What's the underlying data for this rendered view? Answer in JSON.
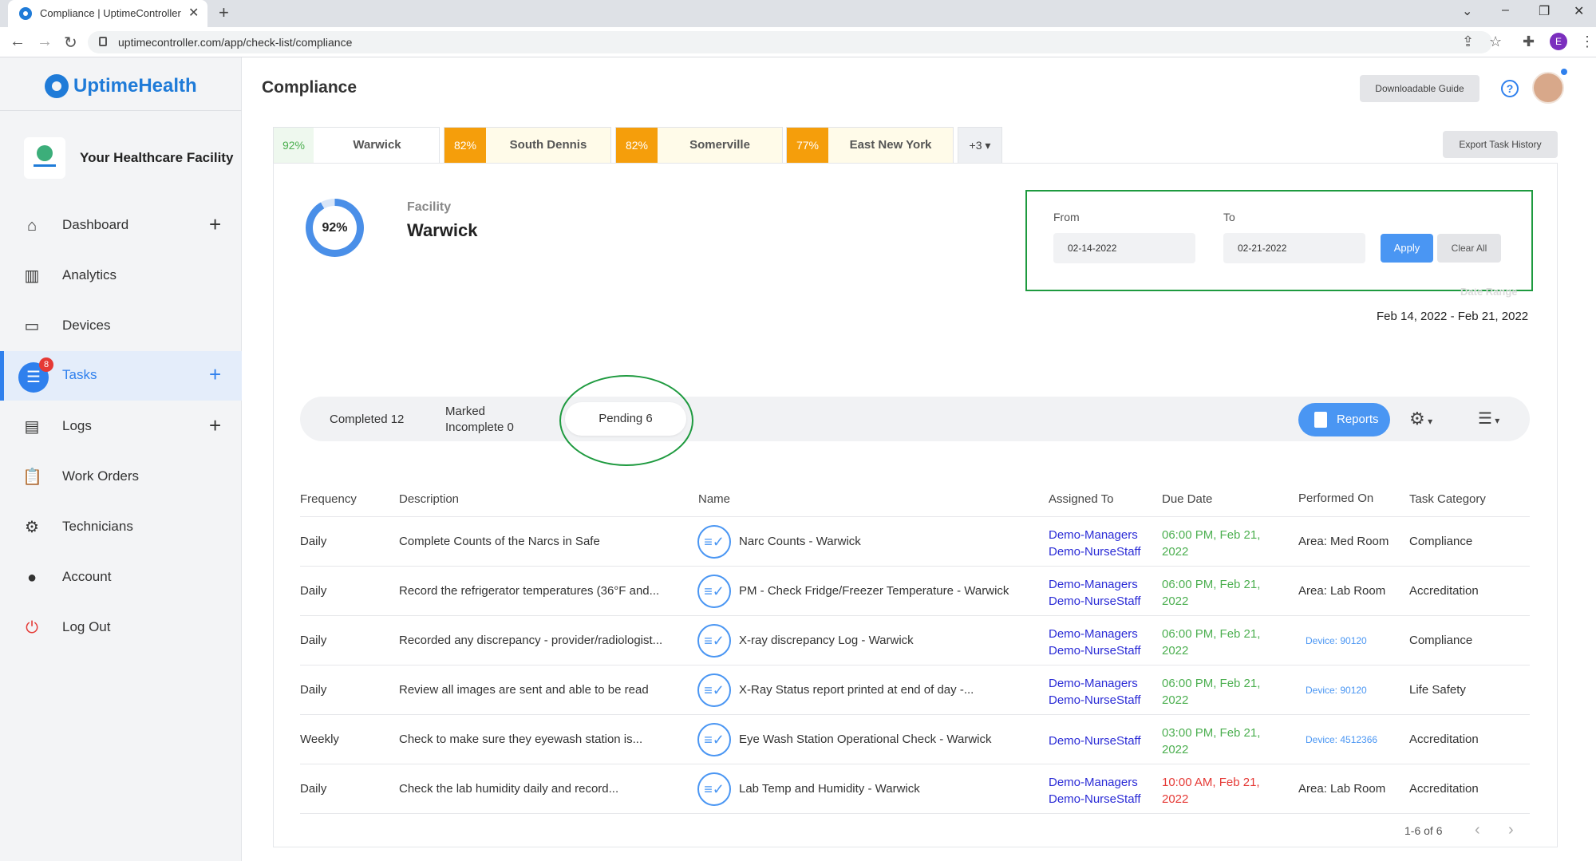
{
  "browser": {
    "tab_title": "Compliance | UptimeController",
    "url": "uptimecontroller.com/app/check-list/compliance",
    "profile_initial": "E"
  },
  "sidebar": {
    "brand": "UptimeHealth",
    "facility_name": "Your Healthcare Facility",
    "items": [
      {
        "label": "Dashboard",
        "icon": "home-icon",
        "has_plus": true
      },
      {
        "label": "Analytics",
        "icon": "bar-chart-icon",
        "has_plus": false
      },
      {
        "label": "Devices",
        "icon": "devices-icon",
        "has_plus": false
      },
      {
        "label": "Tasks",
        "icon": "tasks-list-icon",
        "has_plus": true,
        "badge": "8",
        "active": true
      },
      {
        "label": "Logs",
        "icon": "logs-icon",
        "has_plus": true
      },
      {
        "label": "Work Orders",
        "icon": "clipboard-icon",
        "has_plus": false
      },
      {
        "label": "Technicians",
        "icon": "gear-icon",
        "has_plus": false
      },
      {
        "label": "Account",
        "icon": "account-icon",
        "has_plus": false
      },
      {
        "label": "Log Out",
        "icon": "power-icon",
        "has_plus": false
      }
    ]
  },
  "header": {
    "title": "Compliance",
    "guide_button": "Downloadable Guide",
    "help": "?"
  },
  "facility_tabs": [
    {
      "pct": "92%",
      "name": "Warwick",
      "active": true
    },
    {
      "pct": "82%",
      "name": "South Dennis"
    },
    {
      "pct": "82%",
      "name": "Somerville"
    },
    {
      "pct": "77%",
      "name": "East New York"
    }
  ],
  "more_tab": "+3",
  "export_button": "Export Task History",
  "facility": {
    "score": "92%",
    "score_value": 0.92,
    "label": "Facility",
    "name": "Warwick"
  },
  "date_filter": {
    "from_label": "From",
    "from_value": "02-14-2022",
    "to_label": "To",
    "to_value": "02-21-2022",
    "apply": "Apply",
    "clear": "Clear All",
    "range_caption": "Date Range",
    "range_value": "Feb 14, 2022 - Feb 21, 2022"
  },
  "status": {
    "completed": "Completed 12",
    "marked_1": "Marked",
    "marked_2": "Incomplete 0",
    "pending": "Pending 6",
    "reports": "Reports"
  },
  "table": {
    "headers": [
      "Frequency",
      "Description",
      "Name",
      "Assigned To",
      "Due Date",
      "Performed On",
      "Task Category"
    ],
    "rows": [
      {
        "frequency": "Daily",
        "description": "Complete Counts of the Narcs in Safe",
        "name": "Narc Counts - Warwick",
        "assigned_1": "Demo-Managers",
        "assigned_2": "Demo-NurseStaff",
        "due_1": "06:00 PM, Feb 21,",
        "due_2": "2022",
        "due_color": "green",
        "performed_on": "Area: Med Room",
        "category": "Compliance"
      },
      {
        "frequency": "Daily",
        "description": "Record the refrigerator temperatures (36°F and...",
        "name": "PM - Check Fridge/Freezer Temperature - Warwick",
        "assigned_1": "Demo-Managers",
        "assigned_2": "Demo-NurseStaff",
        "due_1": "06:00 PM, Feb 21,",
        "due_2": "2022",
        "due_color": "green",
        "performed_on": "Area: Lab Room",
        "category": "Accreditation"
      },
      {
        "frequency": "Daily",
        "description": "Recorded any discrepancy - provider/radiologist...",
        "name": "X-ray discrepancy Log - Warwick",
        "assigned_1": "Demo-Managers",
        "assigned_2": "Demo-NurseStaff",
        "due_1": "06:00 PM, Feb 21,",
        "due_2": "2022",
        "due_color": "green",
        "performed_on": "Device: 90120",
        "category": "Compliance"
      },
      {
        "frequency": "Daily",
        "description": "Review all images are sent and able to be read",
        "name": "X-Ray Status report printed at end of day -...",
        "assigned_1": "Demo-Managers",
        "assigned_2": "Demo-NurseStaff",
        "due_1": "06:00 PM, Feb 21,",
        "due_2": "2022",
        "due_color": "green",
        "performed_on": "Device: 90120",
        "category": "Life Safety"
      },
      {
        "frequency": "Weekly",
        "description": "Check to make sure they eyewash station is...",
        "name": "Eye Wash Station Operational Check - Warwick",
        "assigned_1": "Demo-NurseStaff",
        "assigned_2": "",
        "due_1": "03:00 PM, Feb 21,",
        "due_2": "2022",
        "due_color": "green",
        "performed_on": "Device: 4512366",
        "category": "Accreditation"
      },
      {
        "frequency": "Daily",
        "description": "Check the lab humidity daily and record...",
        "name": "Lab Temp and Humidity - Warwick",
        "assigned_1": "Demo-Managers",
        "assigned_2": "Demo-NurseStaff",
        "due_1": "10:00 AM, Feb 21,",
        "due_2": "2022",
        "due_color": "red",
        "performed_on": "Area: Lab Room",
        "category": "Accreditation"
      }
    ]
  },
  "pagination": {
    "label": "1-6 of 6"
  },
  "colors": {
    "accent": "#2f80ed",
    "orange": "#f59e0b",
    "highlight_green": "#1e9a3f",
    "due_green": "#4caf50",
    "due_red": "#e53935"
  }
}
